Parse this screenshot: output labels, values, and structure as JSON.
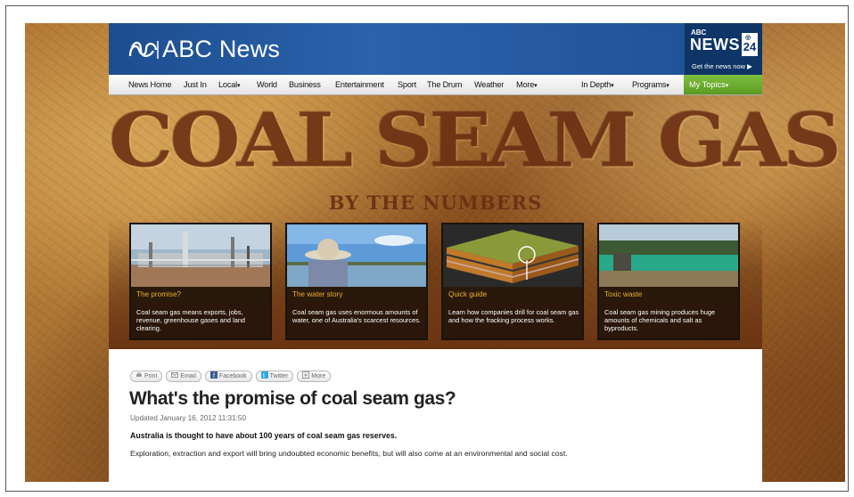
{
  "header": {
    "logo_text": "ABC News",
    "news24": {
      "abc": "ABC",
      "news": "NEWS",
      "number": "24",
      "tagline": "Get the news now ▶"
    }
  },
  "nav": {
    "items": [
      {
        "label": "News Home"
      },
      {
        "label": "Just In"
      },
      {
        "label": "Local",
        "caret": "▾"
      },
      {
        "label": "World"
      },
      {
        "label": "Business"
      },
      {
        "label": "Entertainment"
      },
      {
        "label": "Sport"
      },
      {
        "label": "The Drum"
      },
      {
        "label": "Weather"
      },
      {
        "label": "More",
        "caret": "▾"
      },
      {
        "label": "In Depth",
        "caret": "▾"
      },
      {
        "label": "Programs",
        "caret": "▾"
      }
    ],
    "my_topics": {
      "label": "My Topics",
      "caret": "▾"
    }
  },
  "feature": {
    "title": "COAL SEAM GAS",
    "subtitle": "BY THE NUMBERS"
  },
  "cards": [
    {
      "title": "The promise?",
      "description": "Coal seam gas means exports, jobs, revenue, greenhouse gases and land clearing."
    },
    {
      "title": "The water story",
      "description": "Coal seam gas uses enormous amounts of water, one of Australia's scarcest resources."
    },
    {
      "title": "Quick guide",
      "description": "Learn how companies drill for coal seam gas and how the fracking process works."
    },
    {
      "title": "Toxic waste",
      "description": "Coal seam gas mining produces huge amounts of chemicals and salt as byproducts."
    }
  ],
  "share": {
    "print": "Print",
    "email": "Email",
    "facebook": "Facebook",
    "twitter": "Twitter",
    "more": "More"
  },
  "article": {
    "headline": "What's the promise of coal seam gas?",
    "updated": "Updated January 16, 2012 11:31:50",
    "lead": "Australia is thought to have about 100 years of coal seam gas reserves.",
    "body": "Exploration, extraction and export will bring undoubted economic benefits, but will also come at an environmental and social cost."
  },
  "colors": {
    "header_blue": "#1d4d8f",
    "news24_navy": "#0e3566",
    "my_topics_green": "#6aaa2e",
    "card_title_orange": "#f0b030",
    "feature_title_brown": "#6a2e12"
  }
}
